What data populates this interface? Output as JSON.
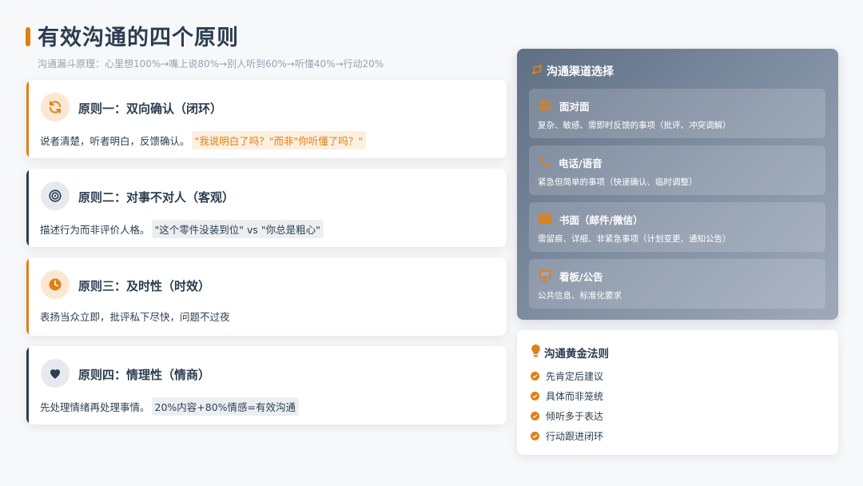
{
  "header": {
    "title": "有效沟通的四个原则",
    "subtitle": "沟通漏斗原理：心里想100%→嘴上说80%→别人听到60%→听懂40%→行动20%"
  },
  "principles": [
    {
      "title": "原则一：双向确认（闭环）",
      "desc": "说者清楚，听者明白，反馈确认。",
      "highlight": "\"我说明白了吗？\"而非\"你听懂了吗？\"",
      "icon": "refresh-icon",
      "accent": "#e07f14"
    },
    {
      "title": "原则二：对事不对人（客观）",
      "desc": "描述行为而非评价人格。",
      "highlight": "\"这个零件没装到位\" vs \"你总是粗心\"",
      "icon": "target-icon",
      "accent": "#2c3e50"
    },
    {
      "title": "原则三：及时性（时效）",
      "desc": "表扬当众立即，批评私下尽快，问题不过夜",
      "highlight": "",
      "icon": "clock-icon",
      "accent": "#e07f14"
    },
    {
      "title": "原则四：情理性（情商）",
      "desc": "先处理情绪再处理事情。",
      "highlight": "20%内容+80%情感=有效沟通",
      "icon": "heart-icon",
      "accent": "#2c3e50"
    }
  ],
  "channels": {
    "title": "沟通渠道选择",
    "items": [
      {
        "name": "面对面",
        "desc": "复杂、敏感、需即时反馈的事项（批评、冲突调解）",
        "icon": "users-icon"
      },
      {
        "name": "电话/语音",
        "desc": "紧急但简单的事项（快速确认、临时调整）",
        "icon": "phone-icon"
      },
      {
        "name": "书面（邮件/微信）",
        "desc": "需留痕、详细、非紧急事项（计划变更、通知公告）",
        "icon": "mail-icon"
      },
      {
        "name": "看板/公告",
        "desc": "公共信息、标准化要求",
        "icon": "board-icon"
      }
    ]
  },
  "rules": {
    "title": "沟通黄金法则",
    "items": [
      "先肯定后建议",
      "具体而非笼统",
      "倾听多于表达",
      "行动跟进闭环"
    ]
  },
  "colors": {
    "accent": "#e07f14",
    "dark": "#2c3e50"
  }
}
